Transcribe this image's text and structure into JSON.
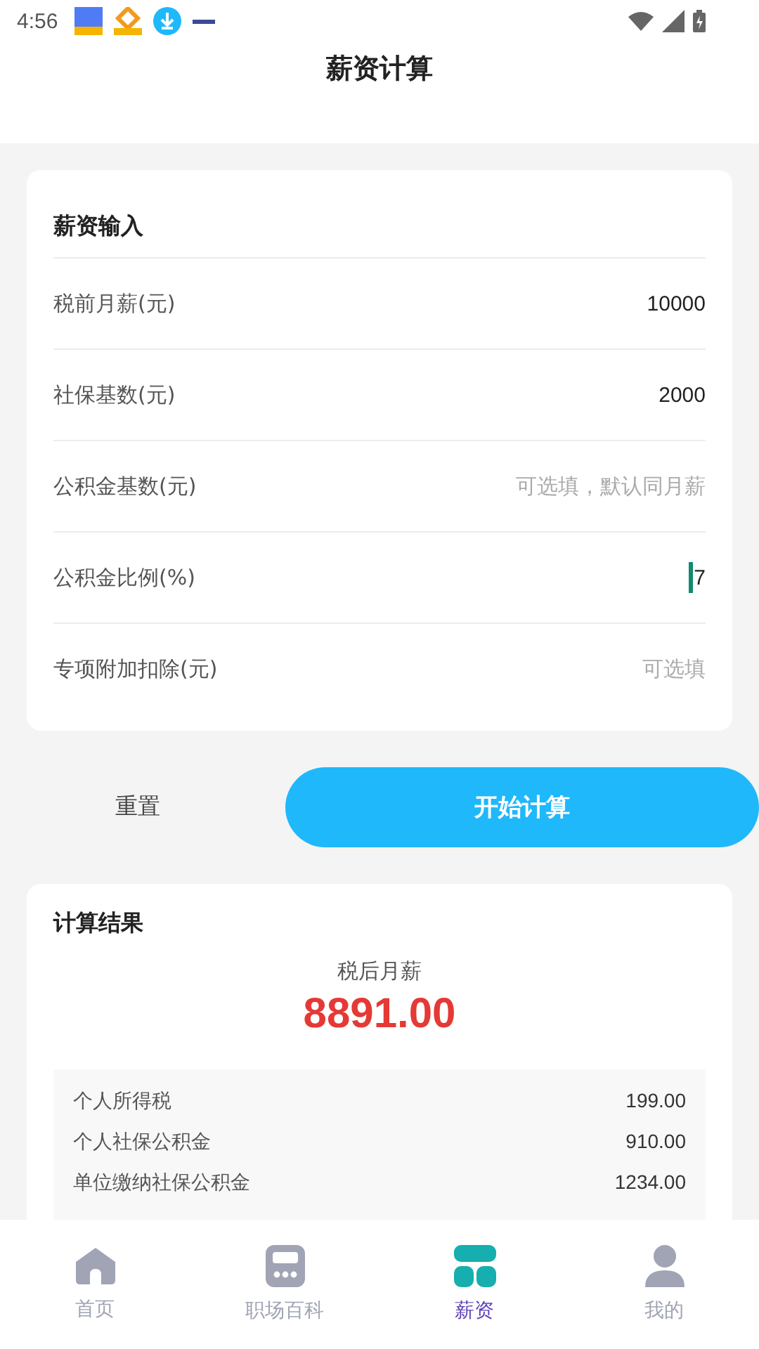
{
  "status_bar": {
    "time": "4:56"
  },
  "header": {
    "title": "薪资计算"
  },
  "input_card": {
    "title": "薪资输入",
    "fields": [
      {
        "label": "税前月薪(元)",
        "value": "10000",
        "focused": false
      },
      {
        "label": "社保基数(元)",
        "value": "2000",
        "focused": false
      },
      {
        "label": "公积金基数(元)",
        "placeholder": "可选填，默认同月薪",
        "focused": false
      },
      {
        "label": "公积金比例(%)",
        "value": "7",
        "focused": true
      },
      {
        "label": "专项附加扣除(元)",
        "placeholder": "可选填",
        "focused": false
      }
    ]
  },
  "buttons": {
    "reset": "重置",
    "calculate": "开始计算"
  },
  "result_card": {
    "title": "计算结果",
    "net_label": "税后月薪",
    "net_value": "8891.00",
    "details": [
      {
        "label": "个人所得税",
        "value": "199.00"
      },
      {
        "label": "个人社保公积金",
        "value": "910.00"
      },
      {
        "label": "单位缴纳社保公积金",
        "value": "1234.00"
      }
    ]
  },
  "tab_bar": [
    {
      "kind": "home",
      "label": "首页",
      "selected": false
    },
    {
      "kind": "wiki",
      "label": "职场百科",
      "selected": false
    },
    {
      "kind": "salary",
      "label": "薪资",
      "selected": true
    },
    {
      "kind": "profile",
      "label": "我的",
      "selected": false
    }
  ]
}
